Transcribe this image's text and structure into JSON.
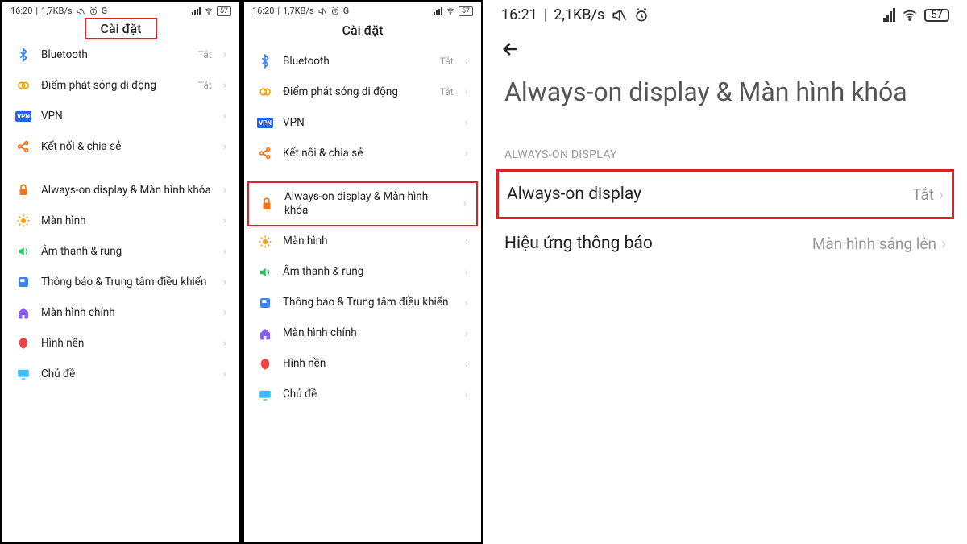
{
  "status_small": {
    "time": "16:20",
    "rate": "1,7KB/s",
    "battery": "57"
  },
  "status_large": {
    "time": "16:21",
    "rate": "2,1KB/s",
    "battery": "57"
  },
  "settings_title": "Cài đặt",
  "items": [
    {
      "icon": "bluetooth",
      "color": "#3b82f6",
      "label": "Bluetooth",
      "value": "Tắt"
    },
    {
      "icon": "hotspot",
      "color": "#f59e0b",
      "label": "Điểm phát sóng di động",
      "value": "Tắt"
    },
    {
      "icon": "vpn",
      "color": "#2563eb",
      "label": "VPN",
      "value": ""
    },
    {
      "icon": "share",
      "color": "#f97316",
      "label": "Kết nối & chia sẻ",
      "value": ""
    }
  ],
  "items2": [
    {
      "icon": "lock",
      "color": "#f97316",
      "label": "Always-on display & Màn hình khóa",
      "value": ""
    },
    {
      "icon": "sun",
      "color": "#f59e0b",
      "label": "Màn hình",
      "value": ""
    },
    {
      "icon": "sound",
      "color": "#22c55e",
      "label": "Âm thanh & rung",
      "value": ""
    },
    {
      "icon": "notif",
      "color": "#3b82f6",
      "label": "Thông báo & Trung tâm điều khiển",
      "value": ""
    },
    {
      "icon": "home",
      "color": "#8b5cf6",
      "label": "Màn hình chính",
      "value": ""
    },
    {
      "icon": "wall",
      "color": "#ef4444",
      "label": "Hình nền",
      "value": ""
    },
    {
      "icon": "theme",
      "color": "#38bdf8",
      "label": "Chủ đề",
      "value": ""
    }
  ],
  "panel3": {
    "title": "Always-on display & Màn hình khóa",
    "section": "ALWAYS-ON DISPLAY",
    "row1": {
      "label": "Always-on display",
      "value": "Tắt"
    },
    "row2": {
      "label": "Hiệu ứng thông báo",
      "value": "Màn hình sáng lên"
    }
  }
}
